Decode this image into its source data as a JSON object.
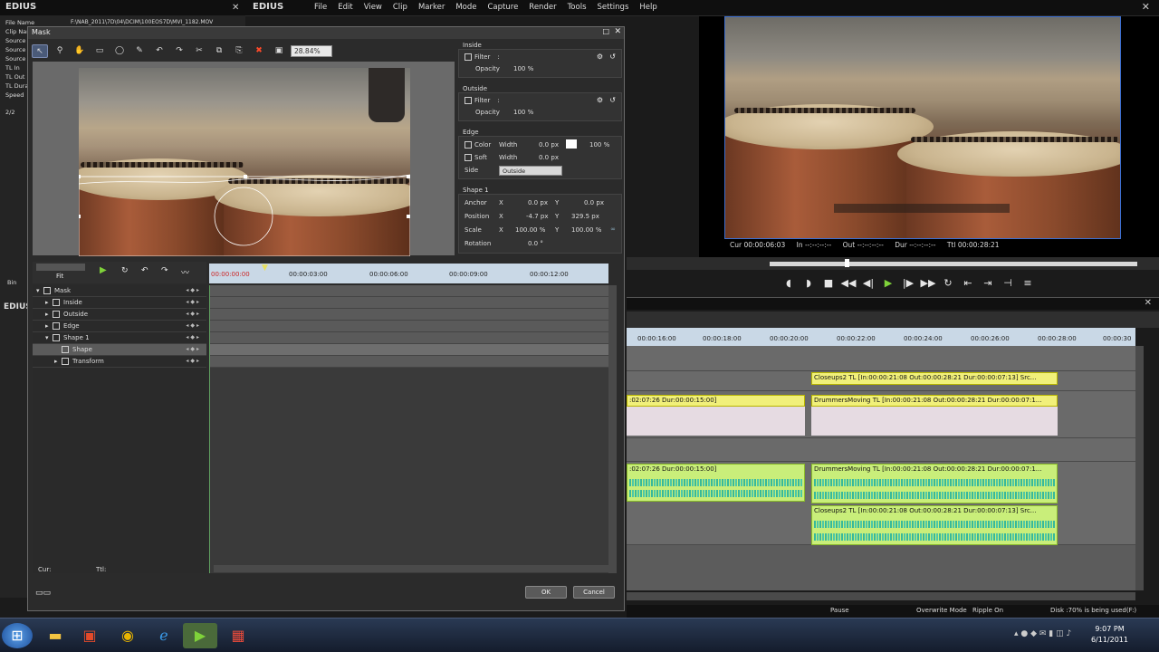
{
  "main": {
    "app_name": "EDIUS",
    "menu": [
      "File",
      "Edit",
      "View",
      "Clip",
      "Marker",
      "Mode",
      "Capture",
      "Render",
      "Tools",
      "Settings",
      "Help"
    ],
    "close_glyph": "✕"
  },
  "bin": {
    "title": "EDIUS",
    "fields": [
      "File Name",
      "Clip Nar",
      "Source",
      "Source",
      "Source",
      "TL In",
      "TL Out",
      "TL Dura",
      "Speed"
    ],
    "file_path": "F:\\NAB_2011\\7D\\04\\DCIM\\100EOS7D\\MVI_1182.MOV",
    "page": "2/2",
    "bin_label": "Bin"
  },
  "recorder": {
    "cur": "Cur 00:00:06:03",
    "in": "In --:--:--:--",
    "out": "Out --:--:--:--",
    "dur": "Dur --:--:--:--",
    "ttl": "Ttl 00:00:28:21"
  },
  "timeline": {
    "ruler": [
      "00:00:16:00",
      "00:00:18:00",
      "00:00:20:00",
      "00:00:22:00",
      "00:00:24:00",
      "00:00:26:00",
      "00:00:28:00",
      "00:00:30"
    ],
    "clips": {
      "v_top": "Closeups2  TL [In:00:00:21:08 Out:00:00:28:21 Dur:00:00:07:13]  Src...",
      "v_left": ":02:07:26 Dur:00:00:15:00]",
      "v_right": "DrummersMoving  TL [In:00:00:21:08 Out:00:00:28:21 Dur:00:00:07:1...",
      "a_left": ":02:07:26 Dur:00:00:15:00]",
      "a_right1": "DrummersMoving  TL [In:00:00:21:08 Out:00:00:28:21 Dur:00:00:07:1...",
      "a_right2": "Closeups2  TL [In:00:00:21:08 Out:00:00:28:21 Dur:00:00:07:13]  Src..."
    }
  },
  "status": {
    "pause": "Pause",
    "mode": "Overwrite Mode",
    "ripple": "Ripple On",
    "disk": "Disk :70% is being used(F:)"
  },
  "mask": {
    "title": "Mask",
    "zoom": "28.84%",
    "inside": {
      "title": "Inside",
      "filter": "Filter",
      "opacity_label": "Opacity",
      "opacity": "100",
      "unit": "%"
    },
    "outside": {
      "title": "Outside",
      "filter": "Filter",
      "opacity_label": "Opacity",
      "opacity": "100",
      "unit": "%"
    },
    "edge": {
      "title": "Edge",
      "color": "Color",
      "color_width_label": "Width",
      "color_width": "0.0",
      "color_pct": "100",
      "soft": "Soft",
      "soft_width_label": "Width",
      "soft_width": "0.0",
      "side_label": "Side",
      "side": "Outside",
      "px": "px",
      "pct": "%"
    },
    "shape": {
      "title": "Shape 1",
      "anchor_label": "Anchor",
      "anchor_x": "0.0",
      "anchor_y": "0.0",
      "position_label": "Position",
      "position_x": "-4.7",
      "position_y": "329.5",
      "scale_label": "Scale",
      "scale_x": "100.00",
      "scale_y": "100.00",
      "rotation_label": "Rotation",
      "rotation": "0.0",
      "deg": "°",
      "x": "X",
      "y": "Y",
      "px": "px",
      "pct": "%"
    },
    "fit": "Fit",
    "kf_ruler": [
      "00:00:00:00",
      "00:00:03:00",
      "00:00:06:00",
      "00:00:09:00",
      "00:00:12:00"
    ],
    "tree": [
      "Mask",
      "Inside",
      "Outside",
      "Edge",
      "Shape 1",
      "Shape",
      "Transform"
    ],
    "cur_label": "Cur:",
    "ttl_label": "Ttl:",
    "ok": "OK",
    "cancel": "Cancel"
  },
  "taskbar": {
    "time": "9:07 PM",
    "date": "6/11/2011"
  },
  "colors": {
    "accent_blue": "#3d6fd0",
    "play_green": "#7fd23a",
    "clip_yellow": "#f1f07a",
    "clip_green": "#c9ee7a",
    "delete_red": "#ff4a2a"
  }
}
